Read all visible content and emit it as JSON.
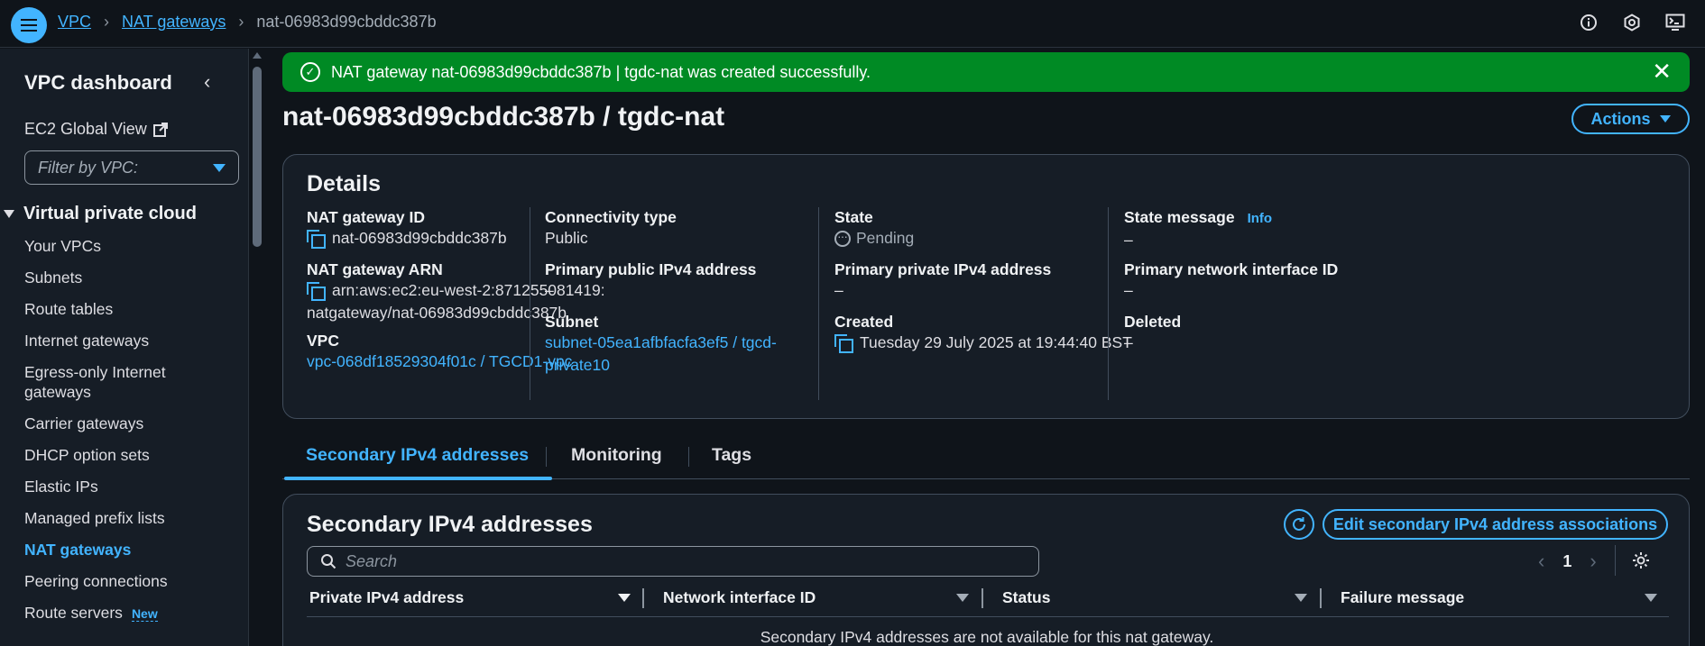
{
  "breadcrumb": {
    "items": [
      "VPC",
      "NAT gateways"
    ],
    "current": "nat-06983d99cbddc387b"
  },
  "sidebar": {
    "title": "VPC dashboard",
    "ec2_global_view": "EC2 Global View",
    "filter_placeholder": "Filter by VPC:",
    "section": "Virtual private cloud",
    "items": [
      {
        "label": "Your VPCs"
      },
      {
        "label": "Subnets"
      },
      {
        "label": "Route tables"
      },
      {
        "label": "Internet gateways"
      },
      {
        "label": "Egress-only Internet gateways"
      },
      {
        "label": "Carrier gateways"
      },
      {
        "label": "DHCP option sets"
      },
      {
        "label": "Elastic IPs"
      },
      {
        "label": "Managed prefix lists"
      },
      {
        "label": "NAT gateways",
        "active": true
      },
      {
        "label": "Peering connections"
      },
      {
        "label": "Route servers",
        "badge": "New"
      }
    ]
  },
  "flash": {
    "message": "NAT gateway nat-06983d99cbddc387b | tgdc-nat was created successfully.",
    "color": "#008a24"
  },
  "page": {
    "title": "nat-06983d99cbddc387b / tgdc-nat",
    "actions_label": "Actions"
  },
  "details": {
    "heading": "Details",
    "nat_gateway_id_label": "NAT gateway ID",
    "nat_gateway_id": "nat-06983d99cbddc387b",
    "nat_gateway_arn_label": "NAT gateway ARN",
    "nat_gateway_arn_line1": "arn:aws:ec2:eu-west-2:871255081419:",
    "nat_gateway_arn_line2": "natgateway/nat-06983d99cbddc387b",
    "vpc_label": "VPC",
    "vpc": "vpc-068df18529304f01c / TGCD1-vpc",
    "connectivity_type_label": "Connectivity type",
    "connectivity_type": "Public",
    "primary_public_ipv4_label": "Primary public IPv4 address",
    "primary_public_ipv4": "–",
    "subnet_label": "Subnet",
    "subnet_line1": "subnet-05ea1afbfacfa3ef5 / tgcd-",
    "subnet_line2": "private10",
    "state_label": "State",
    "state": "Pending",
    "primary_private_ipv4_label": "Primary private IPv4 address",
    "primary_private_ipv4": "–",
    "created_label": "Created",
    "created": "Tuesday 29 July 2025 at 19:44:40 BST",
    "state_message_label": "State message",
    "info_label": "Info",
    "state_message": "–",
    "primary_eni_label": "Primary network interface ID",
    "primary_eni": "–",
    "deleted_label": "Deleted",
    "deleted": "–"
  },
  "tabs": [
    {
      "label": "Secondary IPv4 addresses",
      "active": true
    },
    {
      "label": "Monitoring"
    },
    {
      "label": "Tags"
    }
  ],
  "secondary": {
    "heading": "Secondary IPv4 addresses",
    "edit_button": "Edit secondary IPv4 address associations",
    "search_placeholder": "Search",
    "page_number": "1",
    "columns": [
      "Private IPv4 address",
      "Network interface ID",
      "Status",
      "Failure message"
    ],
    "empty_message": "Secondary IPv4 addresses are not available for this nat gateway."
  },
  "icons": {
    "menu": "hamburger-icon",
    "top_right": [
      "info-icon",
      "settings-hex-icon",
      "cloudshell-icon"
    ],
    "accent": "#42b4ff"
  }
}
